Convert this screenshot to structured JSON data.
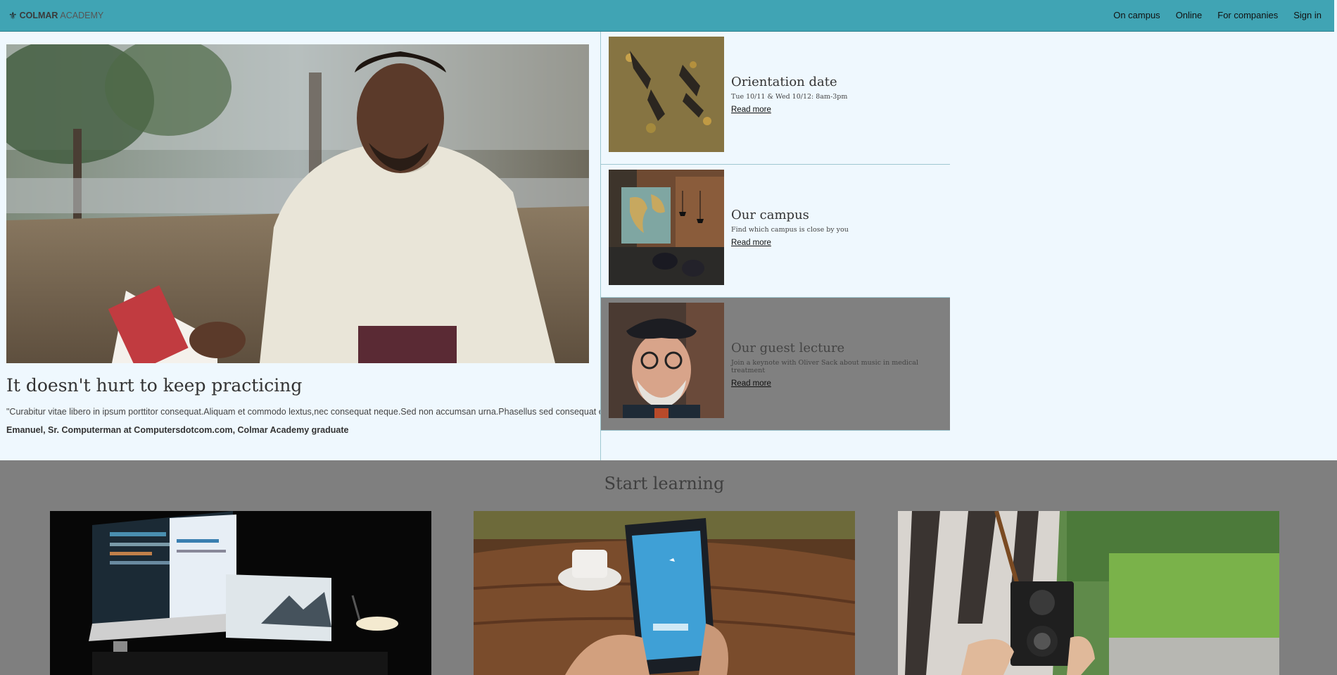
{
  "nav": {
    "logo_bold": "COLMAR",
    "logo_rest": "ACADEMY",
    "links": [
      "On campus",
      "Online",
      "For companies",
      "Sign in"
    ]
  },
  "hero": {
    "title": "It doesn't hurt to keep practicing",
    "quote": "\"Curabitur vitae libero in ipsum porttitor consequat.Aliquam et commodo lextus,nec consequat neque.Sed non accumsan urna.Phasellus sed consequat ex.\"",
    "author": "Emanuel, Sr. Computerman at Computersdotcom.com, Colmar Academy graduate"
  },
  "events": [
    {
      "title": "Orientation date",
      "sub": "Tue 10/11 & Wed 10/12: 8am-3pm",
      "link": "Read more"
    },
    {
      "title": "Our campus",
      "sub": "Find which campus is close by you",
      "link": "Read more"
    },
    {
      "title": "Our guest lecture",
      "sub": "Join a keynote with Oliver Sack about music in medical treatment",
      "link": "Read more"
    }
  ],
  "learn": {
    "title": "Start learning"
  },
  "colors": {
    "nav_bg": "#40a4b4",
    "page_bg": "#eff8fe",
    "overlay": "#808080"
  }
}
